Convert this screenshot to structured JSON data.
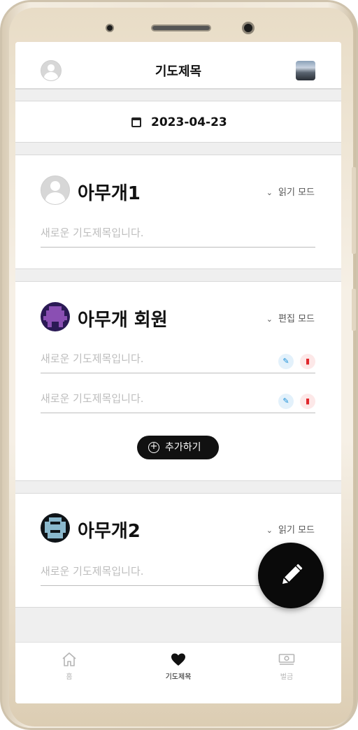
{
  "header": {
    "title": "기도제목"
  },
  "date": "2023-04-23",
  "members": [
    {
      "name": "아무개1",
      "mode": "읽기 모드",
      "prayers": [
        "새로운 기도제목입니다."
      ]
    },
    {
      "name": "아무개 회원",
      "mode": "편집 모드",
      "prayers": [
        "새로운 기도제목입니다.",
        "새로운 기도제목입니다."
      ],
      "add_label": "추가하기"
    },
    {
      "name": "아무개2",
      "mode": "읽기 모드",
      "prayers": [
        "새로운 기도제목입니다."
      ]
    }
  ],
  "nav": [
    {
      "label": "홈",
      "icon": "home-icon",
      "active": false
    },
    {
      "label": "기도제목",
      "icon": "heart-icon",
      "active": true
    },
    {
      "label": "벌금",
      "icon": "money-icon",
      "active": false
    }
  ],
  "colors": {
    "accent": "#111111",
    "edit": "#1b8fd8",
    "delete": "#e0262b",
    "placeholder": "#bdbdbd",
    "gap": "#efefef"
  }
}
